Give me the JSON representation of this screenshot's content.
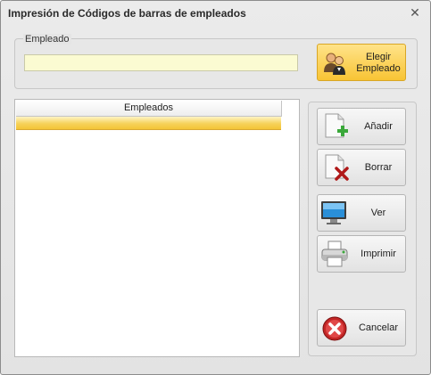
{
  "window": {
    "title": "Impresión de Códigos de barras de empleados",
    "close_glyph": "✕"
  },
  "employee_group": {
    "label": "Empleado",
    "value": "",
    "choose_button_label": "Elegir Empleado",
    "choose_button_icon": "users-icon"
  },
  "table": {
    "columns": [
      "Empleados"
    ],
    "rows": [
      ""
    ]
  },
  "actions": [
    {
      "label": "Añadir",
      "icon": "add-document-icon"
    },
    {
      "label": "Borrar",
      "icon": "delete-document-icon"
    },
    {
      "label": "Ver",
      "icon": "monitor-icon"
    },
    {
      "label": "Imprimir",
      "icon": "printer-icon"
    }
  ],
  "cancel": {
    "label": "Cancelar",
    "icon": "cancel-icon"
  },
  "colors": {
    "highlight_button": "#f8c434",
    "input_background": "#fbfbd2",
    "selection_row": "#f4c436"
  }
}
